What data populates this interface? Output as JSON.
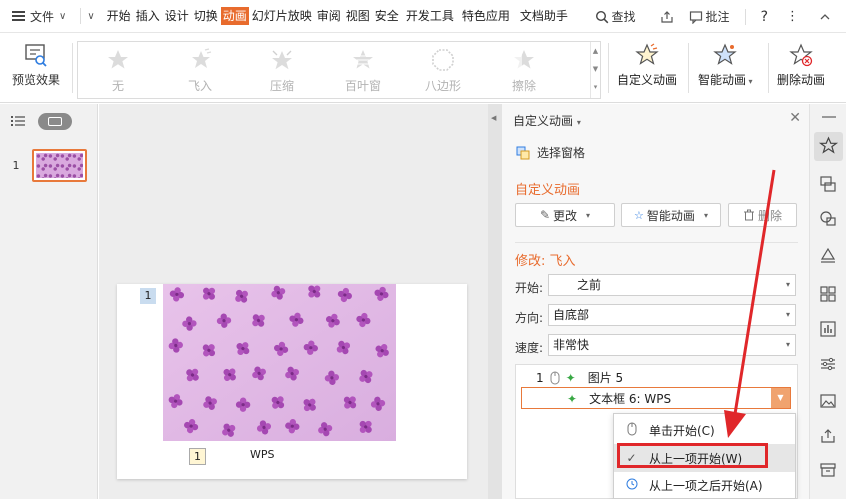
{
  "menubar": {
    "file_label": "文件",
    "tabs": [
      "开始",
      "插入",
      "设计",
      "切换",
      "动画",
      "幻灯片放映",
      "审阅",
      "视图",
      "安全",
      "开发工具",
      "特色应用",
      "文档助手"
    ],
    "active_tab": "动画",
    "search_label": "查找",
    "comment_label": "批注",
    "accent_color": "#e86b2d"
  },
  "ribbon": {
    "preview_label": "预览效果",
    "gallery": [
      "无",
      "飞入",
      "压缩",
      "百叶窗",
      "八边形",
      "擦除"
    ],
    "custom_anim_label": "自定义动画",
    "smart_anim_label": "智能动画",
    "delete_anim_label": "删除动画"
  },
  "slides": {
    "thumb_number": "1",
    "slide_badge": "1",
    "slide_badge2": "1",
    "slide_text": "WPS"
  },
  "anim_pane": {
    "title": "自定义动画",
    "select_pane_label": "选择窗格",
    "section_title": "自定义动画",
    "change_btn": "更改",
    "smart_btn": "智能动画",
    "delete_btn": "删除",
    "modify_title": "修改: 飞入",
    "start_label": "开始:",
    "start_value": "之前",
    "direction_label": "方向:",
    "direction_value": "自底部",
    "speed_label": "速度:",
    "speed_value": "非常快",
    "list": [
      {
        "number": "1",
        "name": "图片 5"
      },
      {
        "number": "",
        "name": "文本框 6: WPS"
      }
    ]
  },
  "dropdown": {
    "items": [
      "单击开始(C)",
      "从上一项开始(W)",
      "从上一项之后开始(A)"
    ],
    "checked_index": 1
  }
}
